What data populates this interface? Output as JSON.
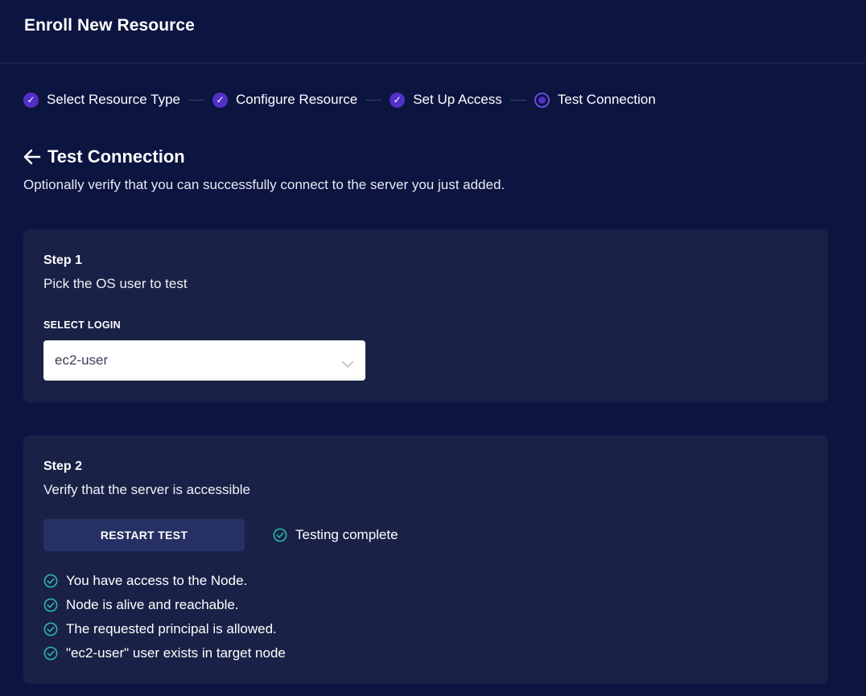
{
  "header": {
    "title": "Enroll New Resource"
  },
  "stepper": {
    "steps": [
      {
        "label": "Select Resource Type",
        "state": "done"
      },
      {
        "label": "Configure Resource",
        "state": "done"
      },
      {
        "label": "Set Up Access",
        "state": "done"
      },
      {
        "label": "Test Connection",
        "state": "current"
      }
    ],
    "check_glyph": "✓"
  },
  "page": {
    "title": "Test Connection",
    "subtitle": "Optionally verify that you can successfully connect to the server you just added."
  },
  "step1": {
    "heading": "Step 1",
    "description": "Pick the OS user to test",
    "select_label": "SELECT LOGIN",
    "select_value": "ec2-user"
  },
  "step2": {
    "heading": "Step 2",
    "description": "Verify that the server is accessible",
    "restart_label": "RESTART TEST",
    "status": "Testing complete",
    "results": [
      "You have access to the Node.",
      "Node is alive and reachable.",
      "The requested principal is allowed.",
      "\"ec2-user\" user exists in target node"
    ]
  },
  "colors": {
    "background": "#0c1440",
    "card": "#1a2147",
    "accent": "#5130c8",
    "success": "#2bb7a5"
  }
}
